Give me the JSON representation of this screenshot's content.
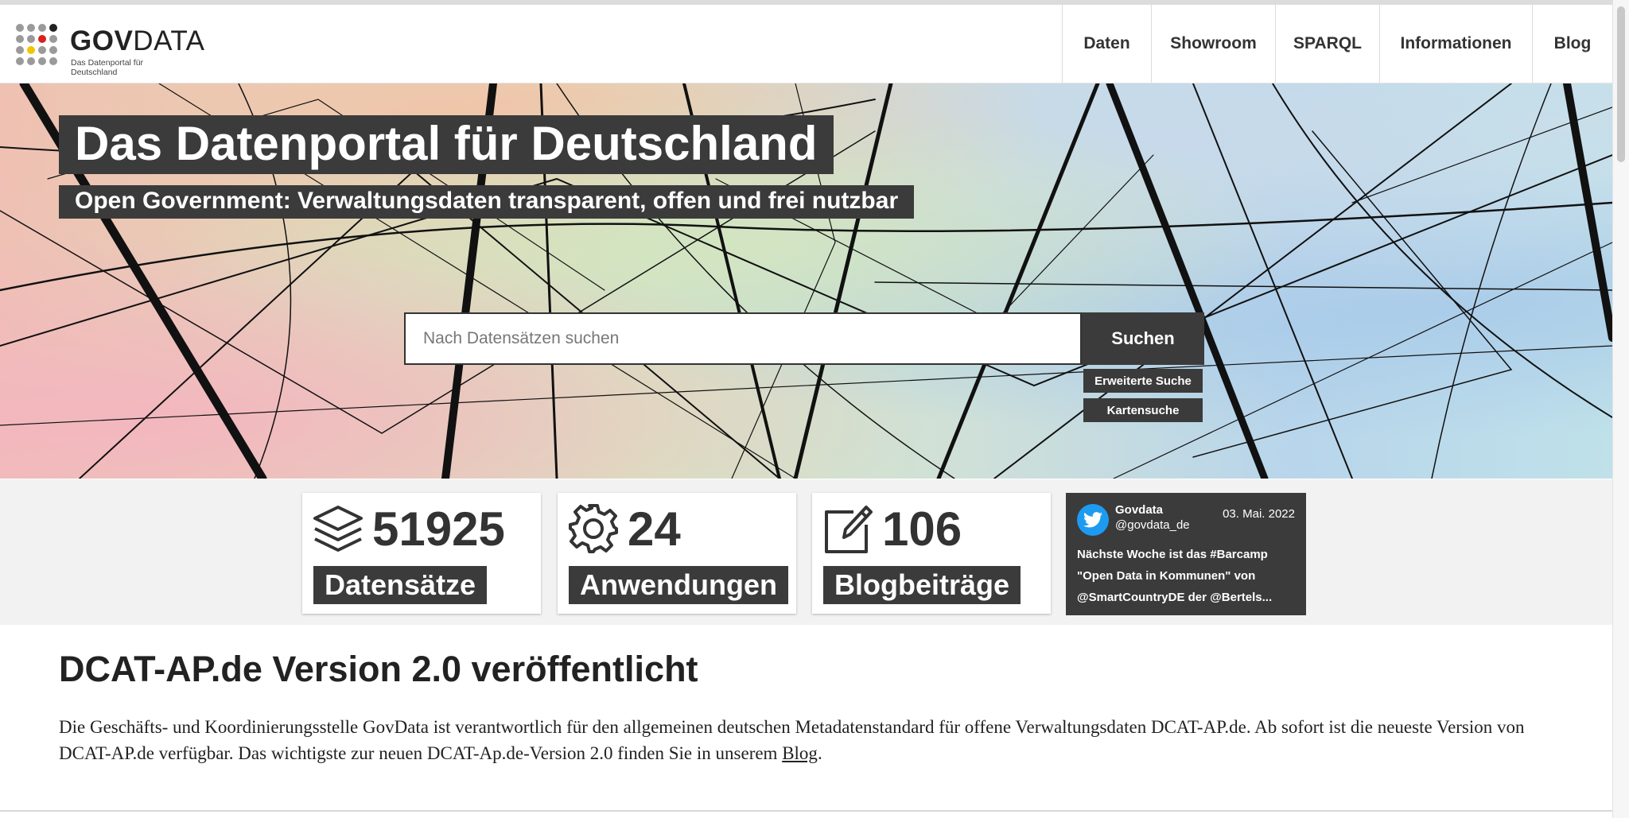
{
  "header": {
    "logo_word_bold": "GOV",
    "logo_word_light": "DATA",
    "logo_subtitle": "Das Datenportal für Deutschland",
    "nav": [
      "Daten",
      "Showroom",
      "SPARQL",
      "Informationen",
      "Blog"
    ]
  },
  "hero": {
    "title": "Das Datenportal für Deutschland",
    "subtitle": "Open Government: Verwaltungsdaten transparent, offen und frei nutzbar",
    "search_placeholder": "Nach Datensätzen suchen",
    "search_button": "Suchen",
    "advanced_search": "Erweiterte Suche",
    "map_search": "Kartensuche"
  },
  "stats": [
    {
      "icon": "layers-icon",
      "value": "51925",
      "label": "Datensätze"
    },
    {
      "icon": "gear-icon",
      "value": "24",
      "label": "Anwendungen"
    },
    {
      "icon": "edit-icon",
      "value": "106",
      "label": "Blogbeiträge"
    }
  ],
  "tweet": {
    "icon": "twitter-icon",
    "name": "Govdata",
    "handle": "@govdata_de",
    "date": "03. Mai. 2022",
    "text": "Nächste Woche ist das #Barcamp \"Open Data in Kommunen\" von @SmartCountryDE der @Bertels..."
  },
  "article": {
    "title": "DCAT-AP.de Version 2.0 veröffentlicht",
    "text_before": "Die Geschäfts- und Koordinierungsstelle GovData ist verantwortlich für den allgemeinen deutschen Metadatenstandard für offene Verwaltungsdaten DCAT-AP.de. Ab sofort ist die neueste Version von DCAT-AP.de verfügbar. Das wichtigste zur neuen DCAT-Ap.de-Version 2.0 finden Sie in unserem ",
    "link": "Blog",
    "text_after": "."
  },
  "colors": {
    "dark_box": "#3b3b3b",
    "twitter_blue": "#1d9bf0",
    "logo_red": "#d8211c",
    "logo_yellow": "#f2c500",
    "logo_black": "#222222"
  }
}
